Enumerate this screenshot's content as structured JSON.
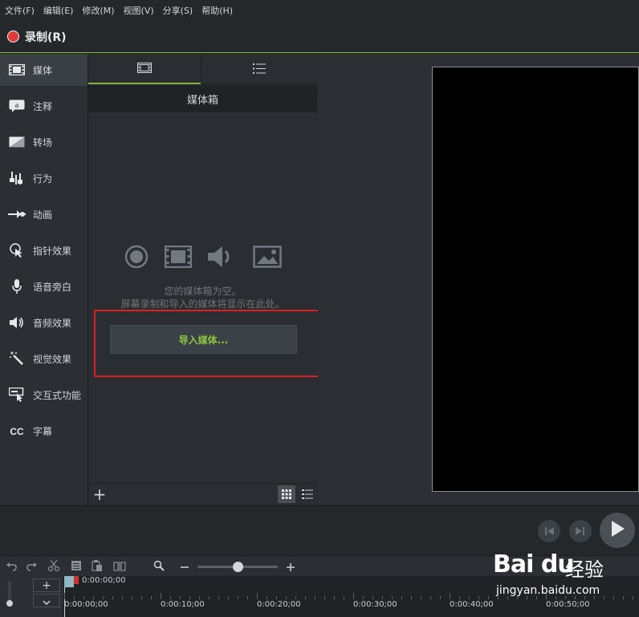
{
  "menu": [
    "文件(F)",
    "编辑(E)",
    "修改(M)",
    "视图(V)",
    "分享(S)",
    "帮助(H)"
  ],
  "record": {
    "label": "录制(R)"
  },
  "tools": [
    {
      "label": "媒体",
      "icon": "film-icon",
      "active": true
    },
    {
      "label": "注释",
      "icon": "annotation-icon"
    },
    {
      "label": "转场",
      "icon": "transition-icon"
    },
    {
      "label": "行为",
      "icon": "behavior-icon"
    },
    {
      "label": "动画",
      "icon": "animation-icon"
    },
    {
      "label": "指针效果",
      "icon": "cursor-effect-icon"
    },
    {
      "label": "语音旁白",
      "icon": "microphone-icon"
    },
    {
      "label": "音频效果",
      "icon": "speaker-icon"
    },
    {
      "label": "视觉效果",
      "icon": "magic-wand-icon"
    },
    {
      "label": "交互式功能",
      "icon": "interactive-icon"
    },
    {
      "label": "字幕",
      "icon": "cc-icon"
    }
  ],
  "media": {
    "bin_title": "媒体箱",
    "empty_line1": "您的媒体箱为空。",
    "empty_line2": "屏幕录制和导入的媒体将显示在此处。",
    "import_label": "导入媒体..."
  },
  "timeline": {
    "playhead_time": "0:00:00;00",
    "labels": [
      "0:00:00;00",
      "0:00:10;00",
      "0:00:20;00",
      "0:00:30;00",
      "0:00:40;00",
      "0:00:50;00"
    ]
  },
  "watermark": {
    "brand": "Bai du",
    "brand_cn": "经验",
    "url": "jingyan.baidu.com"
  },
  "colors": {
    "accent": "#7fb539",
    "highlight": "#e02020",
    "import_text": "#8cc63f",
    "record": "#e03a3a"
  }
}
